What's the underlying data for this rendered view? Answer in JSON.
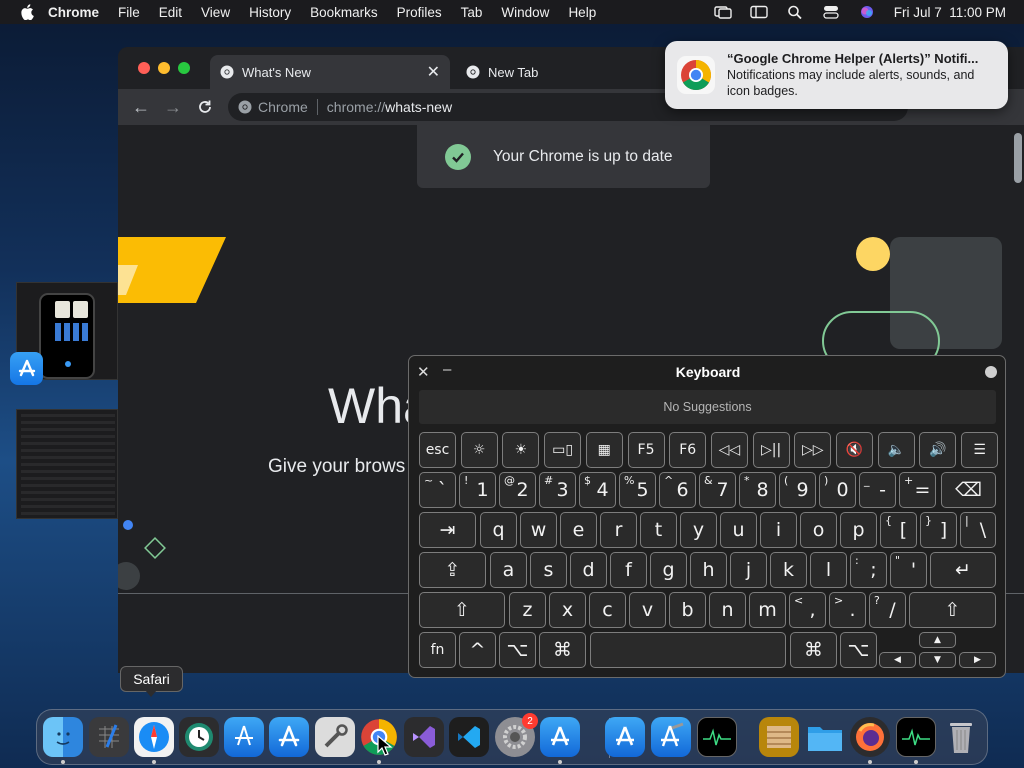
{
  "menubar": {
    "app": "Chrome",
    "items": [
      "File",
      "Edit",
      "View",
      "History",
      "Bookmarks",
      "Profiles",
      "Tab",
      "Window",
      "Help"
    ],
    "clock": "Fri Jul 7  11:00 PM"
  },
  "browser": {
    "tabs": [
      {
        "title": "What's New",
        "active": true
      },
      {
        "title": "New Tab",
        "active": false
      }
    ],
    "omnibox": {
      "site_label": "Chrome",
      "url_scheme": "chrome://",
      "url_path": "whats-new"
    },
    "toast": "Your Chrome is up to date",
    "page_title": "Wha",
    "page_subtitle": "Give your brows"
  },
  "notification": {
    "title": "“Google Chrome Helper (Alerts)” Notifi...",
    "body": "Notifications may include alerts, sounds, and icon badges."
  },
  "keyboard_viewer": {
    "title": "Keyboard",
    "suggestions": "No Suggestions",
    "function_row": [
      "esc",
      "☼",
      "☀",
      "▭▯",
      "▦",
      "F5",
      "F6",
      "◁◁",
      "▷||",
      "▷▷",
      "🔇",
      "🔈",
      "🔊",
      "☰"
    ],
    "number_row": [
      {
        "shift": "~",
        "main": "`"
      },
      {
        "shift": "!",
        "main": "1"
      },
      {
        "shift": "@",
        "main": "2"
      },
      {
        "shift": "#",
        "main": "3"
      },
      {
        "shift": "$",
        "main": "4"
      },
      {
        "shift": "%",
        "main": "5"
      },
      {
        "shift": "^",
        "main": "6"
      },
      {
        "shift": "&",
        "main": "7"
      },
      {
        "shift": "*",
        "main": "8"
      },
      {
        "shift": "(",
        "main": "9"
      },
      {
        "shift": ")",
        "main": "0"
      },
      {
        "shift": "_",
        "main": "-"
      },
      {
        "shift": "+",
        "main": "="
      },
      {
        "shift": "",
        "main": "⌫"
      }
    ],
    "top_row": [
      "⇥",
      "q",
      "w",
      "e",
      "r",
      "t",
      "y",
      "u",
      "i",
      "o",
      "p",
      {
        "shift": "{",
        "main": "["
      },
      {
        "shift": "}",
        "main": "]"
      },
      {
        "shift": "|",
        "main": "\\"
      }
    ],
    "home_row": [
      "⇪",
      "a",
      "s",
      "d",
      "f",
      "g",
      "h",
      "j",
      "k",
      "l",
      {
        "shift": ":",
        "main": ";"
      },
      {
        "shift": "\"",
        "main": "'"
      },
      "↵"
    ],
    "bottom_row": [
      "⇧",
      "z",
      "x",
      "c",
      "v",
      "b",
      "n",
      "m",
      {
        "shift": "<",
        "main": ","
      },
      {
        "shift": ">",
        "main": "."
      },
      {
        "shift": "?",
        "main": "/"
      },
      "⇧"
    ],
    "modifier_row": [
      "fn",
      "^",
      "⌥",
      "⌘",
      "",
      "⌘",
      "⌥"
    ],
    "arrows": [
      "▲",
      "◀",
      "▼",
      "▶"
    ]
  },
  "dock": {
    "tooltip": "Safari",
    "badge": "2",
    "apps": [
      "Finder",
      "Launchpad",
      "Safari",
      "Time Machine",
      "Migrate",
      "App Store",
      "Utility",
      "Google Chrome",
      "Visual Studio",
      "VS Code",
      "System Settings",
      "Xcode Helper",
      "App Store",
      "Xcode",
      "Activity Monitor",
      "Archive",
      "Folder",
      "Firefox",
      "Activity Monitor",
      "Trash"
    ]
  }
}
